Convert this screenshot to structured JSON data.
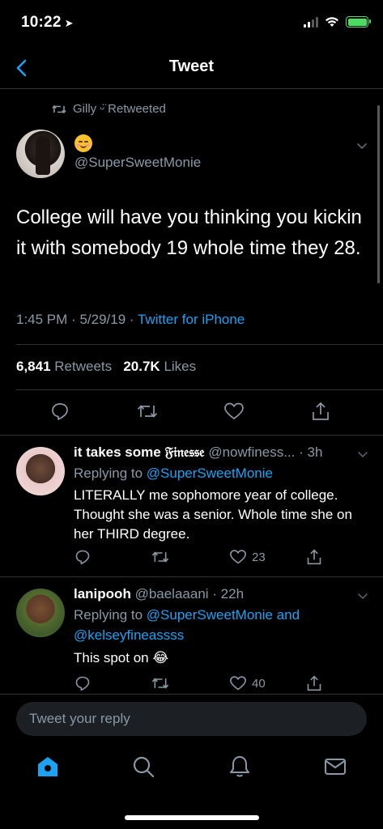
{
  "status_bar": {
    "time": "10:22"
  },
  "nav": {
    "title": "Tweet"
  },
  "tweet": {
    "retweeted_by": "Gilly ᵕ̈ Retweeted",
    "handle": "@SuperSweetMonie",
    "text": "College will have you thinking you kickin it with somebody 19 whole time they 28.",
    "time": "1:45 PM",
    "date": "5/29/19",
    "source": "Twitter for iPhone",
    "retweets_count": "6,841",
    "retweets_label": "Retweets",
    "likes_count": "20.7K",
    "likes_label": "Likes"
  },
  "replies": [
    {
      "name": "it takes some 𝔉𝔦𝔫𝔢𝔰𝔰𝔢",
      "handle": "@nowfiness...",
      "time": "· 3h",
      "replying_prefix": "Replying to",
      "replying_to": "@SuperSweetMonie",
      "text": "LITERALLY me sophomore year of college. Thought she was a senior. Whole time she on her THIRD degree.",
      "likes": "23"
    },
    {
      "name": "lanipooh",
      "handle": "@baelaaani",
      "time": "· 22h",
      "replying_prefix": "Replying to",
      "replying_to": "@SuperSweetMonie and",
      "replying_to_2": "@kelseyfineassss",
      "text": "This spot on 😂",
      "likes": "40"
    }
  ],
  "reply_box": {
    "placeholder": "Tweet your reply"
  },
  "colors": {
    "accent": "#1da1f2",
    "secondary_text": "#8899a6",
    "divider": "#2f3336",
    "background": "#000000"
  }
}
